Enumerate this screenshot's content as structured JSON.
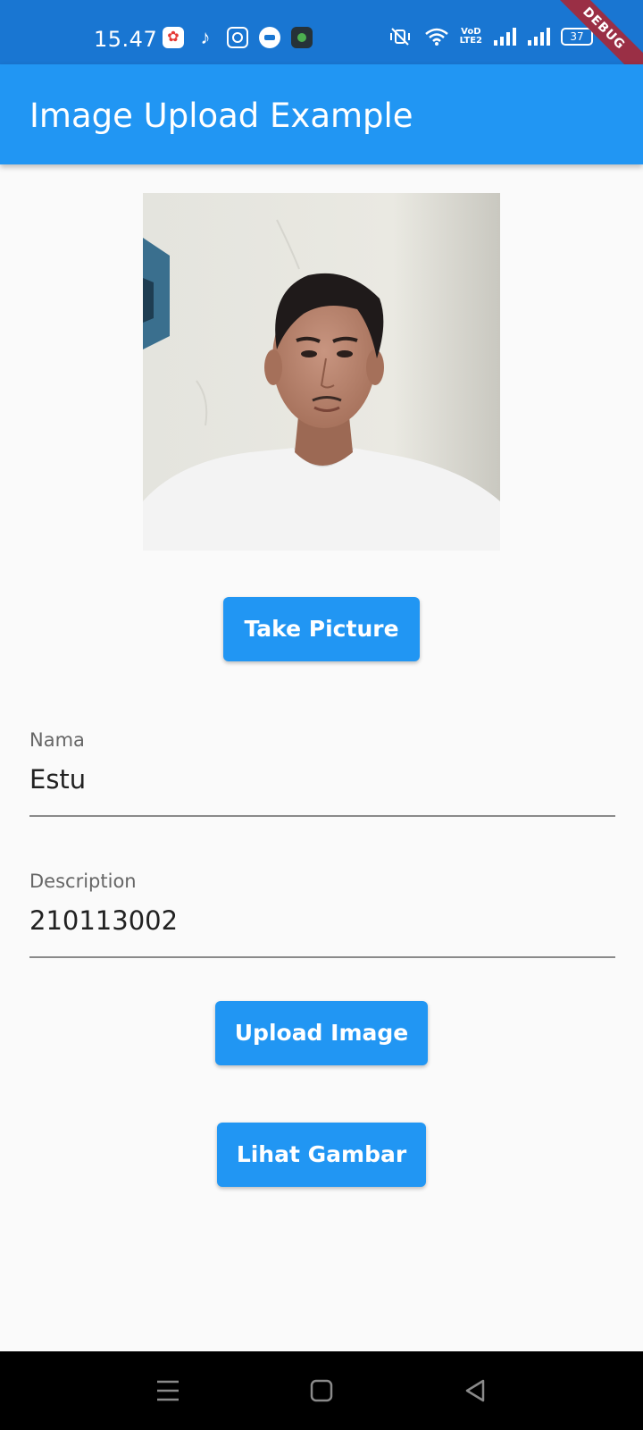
{
  "status_bar": {
    "time": "15.47",
    "notification_icons": [
      "photos-icon",
      "tiktok-icon",
      "instagram-icon",
      "message-icon",
      "app-icon"
    ],
    "system_icons": [
      "mute-vibrate-icon",
      "wifi-icon",
      "volte-icon",
      "signal-icon",
      "signal-icon",
      "battery-icon",
      "charging-icon"
    ],
    "volte_line1": "VoD",
    "volte_line2": "LTE2",
    "battery_level": "37",
    "debug_label": "DEBUG"
  },
  "app_bar": {
    "title": "Image Upload Example"
  },
  "photo": {
    "description_icon": "selfie-photo"
  },
  "buttons": {
    "take_picture": "Take Picture",
    "upload_image": "Upload Image",
    "view_images": "Lihat Gambar"
  },
  "form": {
    "name_label": "Nama",
    "name_value": "Estu",
    "description_label": "Description",
    "description_value": "210113002"
  },
  "nav_bar": {
    "icons": [
      "menu-icon",
      "home-icon",
      "back-icon"
    ]
  },
  "colors": {
    "status_bar": "#1976d2",
    "app_bar": "#2196f3",
    "button": "#2196f3",
    "background": "#fafafa",
    "debug_banner": "#9a2f45"
  }
}
